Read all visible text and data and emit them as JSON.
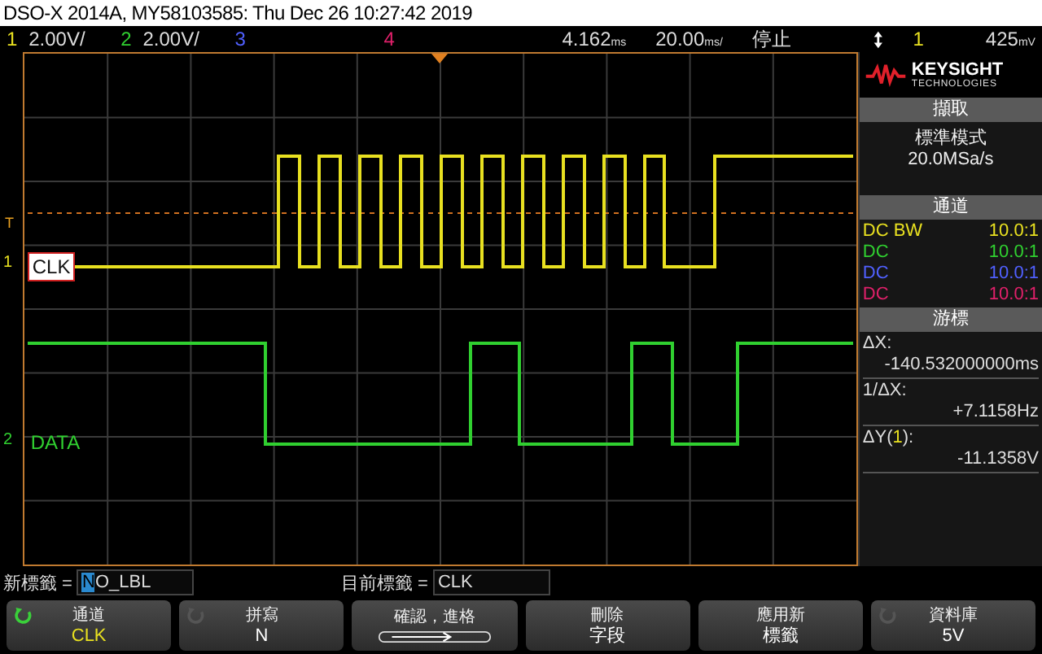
{
  "window": {
    "title": "DSO-X 2014A, MY58103585: Thu Dec 26 10:27:42 2019"
  },
  "status_bar": {
    "channels": [
      {
        "number": "1",
        "scale": "2.00V/",
        "color": "#e8e020"
      },
      {
        "number": "2",
        "scale": "2.00V/",
        "color": "#30d030"
      },
      {
        "number": "3",
        "color": "#5060ff"
      },
      {
        "number": "4",
        "color": "#e0206a"
      }
    ],
    "delay": "4.162",
    "delay_unit": "ms",
    "timebase": "20.00",
    "timebase_unit": "ms/",
    "run_state": "停止",
    "trigger_source": "1",
    "trigger_level": "425",
    "trigger_unit": "mV"
  },
  "screen": {
    "trigger_mark": "T",
    "traces": [
      {
        "channel": "1",
        "label": "CLK",
        "color": "#e8e020",
        "selected": true
      },
      {
        "channel": "2",
        "label": "DATA",
        "color": "#30d030",
        "selected": false
      }
    ]
  },
  "sidebar": {
    "brand": {
      "name": "KEYSIGHT",
      "subtitle": "TECHNOLOGIES"
    },
    "acquisition": {
      "title": "擷取",
      "mode": "標準模式",
      "rate": "20.0MSa/s"
    },
    "channels": {
      "title": "通道",
      "rows": [
        {
          "coupling": "DC BW",
          "ratio": "10.0:1",
          "color": "#e8e020"
        },
        {
          "coupling": "DC",
          "ratio": "10.0:1",
          "color": "#30d030"
        },
        {
          "coupling": "DC",
          "ratio": "10.0:1",
          "color": "#5060ff"
        },
        {
          "coupling": "DC",
          "ratio": "10.0:1",
          "color": "#e0206a"
        }
      ]
    },
    "cursors": {
      "title": "游標",
      "readouts": [
        {
          "label": "ΔX:",
          "value": "-140.532000000ms"
        },
        {
          "label": "1/ΔX:",
          "value": "+7.1158Hz"
        },
        {
          "label": "ΔY(",
          "channel": "1",
          "label_end": "):",
          "value": "-11.1358V"
        }
      ]
    }
  },
  "label_row": {
    "new_label": {
      "label": "新標籤 =",
      "cursor_char": "N",
      "value": "O_LBL"
    },
    "current_label": {
      "label": "目前標籤 =",
      "value": "CLK"
    }
  },
  "softkeys": [
    {
      "kind": "knob",
      "active": true,
      "label": "通道",
      "value": "CLK",
      "color": "#e8e020"
    },
    {
      "kind": "knob",
      "active": false,
      "label": "拼寫",
      "value": "N",
      "color": "#ffffff"
    },
    {
      "kind": "slider",
      "label": "確認，進格"
    },
    {
      "kind": "plain",
      "label": "刪除",
      "value": "字段",
      "color": "#ffffff"
    },
    {
      "kind": "plain",
      "label": "應用新",
      "value": "標籤",
      "color": "#ffffff"
    },
    {
      "kind": "knob",
      "active": false,
      "label": "資料庫",
      "value": "5V",
      "color": "#ffffff"
    }
  ]
}
